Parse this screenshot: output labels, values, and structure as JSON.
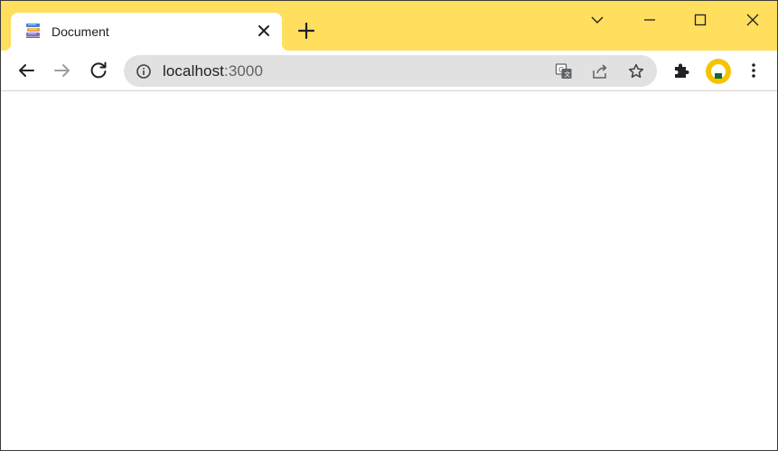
{
  "browser": {
    "tab": {
      "title": "Document",
      "favicon": "books-icon"
    },
    "address_bar": {
      "host": "localhost",
      "port": ":3000"
    },
    "icons": {
      "back": "arrow-left-icon",
      "forward": "arrow-right-icon",
      "reload": "reload-icon",
      "info": "info-icon",
      "translate": "translate-icon",
      "share": "share-icon",
      "bookmark": "star-icon",
      "extensions": "puzzle-icon",
      "menu": "kebab-menu-icon",
      "tab_search": "chevron-down-icon",
      "minimize": "minimize-icon",
      "maximize": "maximize-icon",
      "close": "close-icon"
    },
    "colors": {
      "frame": "#ffdf5d",
      "omnibox": "#e1e1e1",
      "avatar": "#f5c400"
    }
  }
}
